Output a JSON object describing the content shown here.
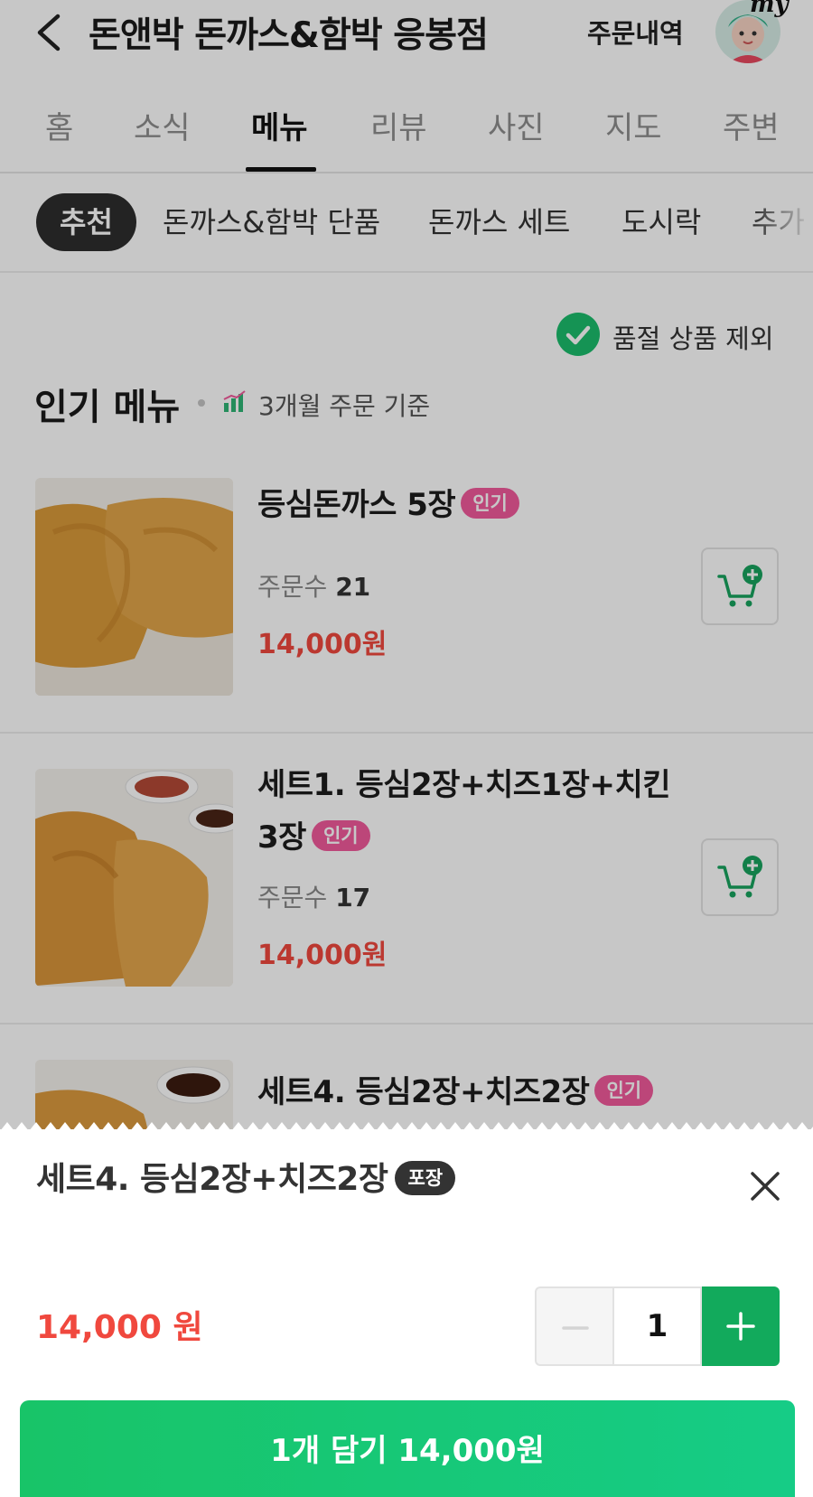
{
  "header": {
    "store_name": "돈앤박 돈까스&함박 응봉점",
    "orders_link": "주문내역",
    "avatar_label": "my"
  },
  "tabs": [
    "홈",
    "소식",
    "메뉴",
    "리뷰",
    "사진",
    "지도",
    "주변"
  ],
  "active_tab": "메뉴",
  "categories": [
    "추천",
    "돈까스&함박 단품",
    "돈까스 세트",
    "도시락",
    "추가"
  ],
  "active_category": "추천",
  "filter": {
    "label": "품절 상품 제외",
    "checked": true
  },
  "popular": {
    "title": "인기 메뉴",
    "subtitle": "3개월 주문 기준",
    "items": [
      {
        "name": "등심돈까스 5장",
        "badge": "인기",
        "orders_label": "주문수",
        "orders": "21",
        "price": "14,000원"
      },
      {
        "name_line1": "세트1. 등심2장+치즈1장+치킨",
        "name_line2": "3장",
        "badge": "인기",
        "orders_label": "주문수",
        "orders": "17",
        "price": "14,000원"
      },
      {
        "name": "세트4. 등심2장+치즈2장",
        "badge": "인기"
      }
    ]
  },
  "sheet": {
    "title": "세트4. 등심2장+치즈2장",
    "badge": "포장",
    "price": "14,000 원",
    "quantity": "1",
    "add_button": "1개 담기 14,000원"
  },
  "colors": {
    "accent_green": "#12aa5c",
    "price_red": "#f0483e",
    "badge_pink": "#f15a9b"
  },
  "icons": [
    "back-arrow-icon",
    "check-circle-icon",
    "chart-icon",
    "cart-plus-icon",
    "close-icon",
    "minus-icon",
    "plus-icon"
  ]
}
